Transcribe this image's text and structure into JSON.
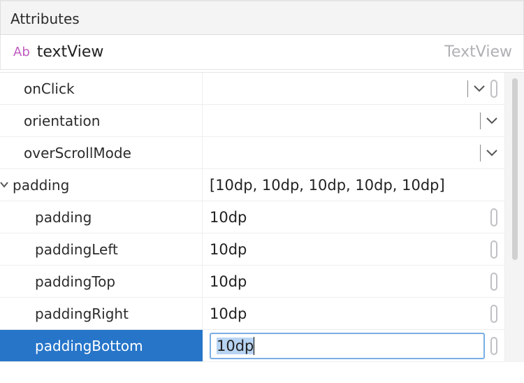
{
  "panel": {
    "title": "Attributes"
  },
  "component": {
    "iconLabel": "Ab",
    "id": "textView",
    "type": "TextView"
  },
  "rows": {
    "onClick": {
      "label": "onClick",
      "value": ""
    },
    "orientation": {
      "label": "orientation",
      "value": ""
    },
    "overScrollMode": {
      "label": "overScrollMode",
      "value": ""
    },
    "paddingGroup": {
      "label": "padding",
      "summary": "[10dp, 10dp, 10dp, 10dp, 10dp]"
    },
    "padding": {
      "label": "padding",
      "value": "10dp"
    },
    "paddingLeft": {
      "label": "paddingLeft",
      "value": "10dp"
    },
    "paddingTop": {
      "label": "paddingTop",
      "value": "10dp"
    },
    "paddingRight": {
      "label": "paddingRight",
      "value": "10dp"
    },
    "paddingBottom": {
      "label": "paddingBottom",
      "value": "10dp"
    }
  }
}
